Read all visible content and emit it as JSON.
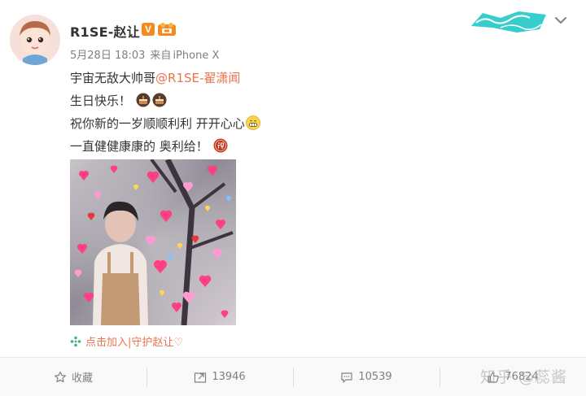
{
  "post": {
    "author": "R1SE-赵让",
    "verified_badge": "V",
    "date": "5月28日 18:03",
    "source_prefix": "来自",
    "source_device": "iPhone X",
    "lines": {
      "line1_prefix": "宇宙无敌大帅哥",
      "line1_mention": "@R1SE-翟潇闻",
      "line2": "生日快乐！",
      "line3": "祝你新的一岁顺顺利利 开开心心",
      "line4": "一直健健康康的 奥利给！"
    },
    "emoji": {
      "line2": [
        "cake-emoji",
        "cake-emoji"
      ],
      "line3": [
        "grin-emoji"
      ],
      "line4": [
        "de-emoji"
      ]
    },
    "topic_link": "点击加入|守护赵让♡",
    "colors": {
      "accent": "#eb7350",
      "meta": "#808080",
      "verified": "#f58a1f",
      "banner": "#21c8c8"
    }
  },
  "actions": {
    "favorite_label": "收藏",
    "repost_count": "13946",
    "comment_count": "10539",
    "like_count": "76824"
  },
  "watermark": "知乎 @蕊酱",
  "icons": {
    "favorite": "star-icon",
    "repost": "repost-icon",
    "comment": "comment-icon",
    "like": "thumb-icon",
    "menu": "chevron-down-icon"
  }
}
